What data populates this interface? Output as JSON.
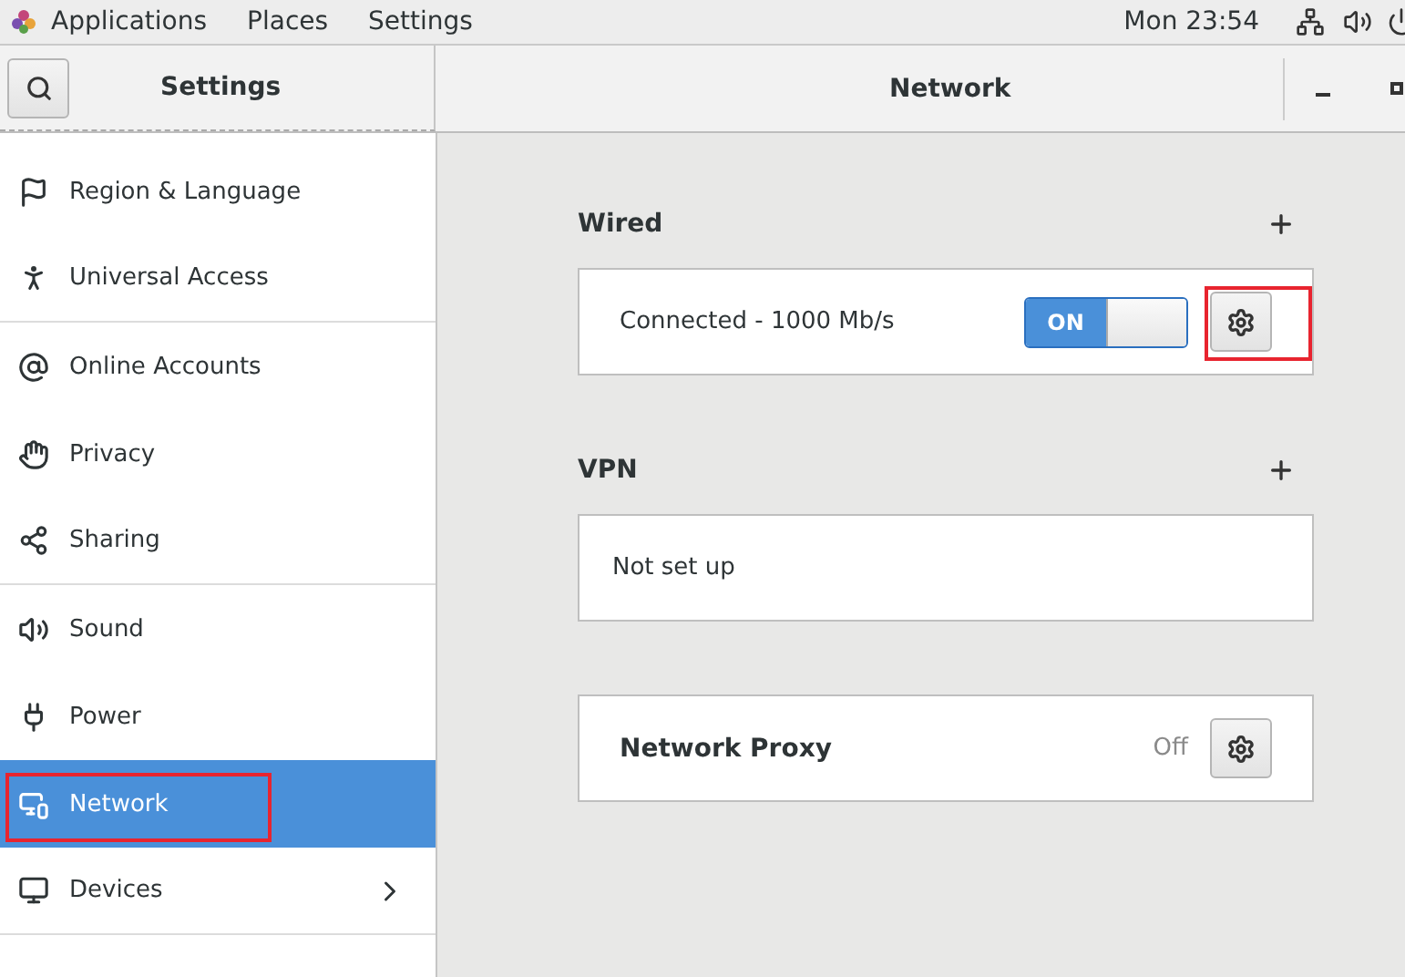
{
  "top_bar": {
    "menus": [
      "Applications",
      "Places",
      "Settings"
    ],
    "clock": "Mon 23:54"
  },
  "header": {
    "sidebar_title": "Settings",
    "title": "Network"
  },
  "sidebar": {
    "items": [
      {
        "label": "Region & Language",
        "selected": false,
        "highlighted": false,
        "has_children": false,
        "group_end": false
      },
      {
        "label": "Universal Access",
        "selected": false,
        "highlighted": false,
        "has_children": false,
        "group_end": true
      },
      {
        "label": "Online Accounts",
        "selected": false,
        "highlighted": false,
        "has_children": false,
        "group_end": false
      },
      {
        "label": "Privacy",
        "selected": false,
        "highlighted": false,
        "has_children": false,
        "group_end": false
      },
      {
        "label": "Sharing",
        "selected": false,
        "highlighted": false,
        "has_children": false,
        "group_end": true
      },
      {
        "label": "Sound",
        "selected": false,
        "highlighted": false,
        "has_children": false,
        "group_end": false
      },
      {
        "label": "Power",
        "selected": false,
        "highlighted": false,
        "has_children": false,
        "group_end": false
      },
      {
        "label": "Network",
        "selected": true,
        "highlighted": true,
        "has_children": false,
        "group_end": false
      },
      {
        "label": "Devices",
        "selected": false,
        "highlighted": false,
        "has_children": true,
        "group_end": true
      }
    ]
  },
  "sections": [
    {
      "heading": "Wired",
      "rows": [
        {
          "kind": "connection",
          "label": "Connected - 1000 Mb/s",
          "switch_label": "ON",
          "on": true,
          "highlighted": true
        }
      ]
    },
    {
      "heading": "VPN",
      "rows": [
        {
          "kind": "empty",
          "label": "Not set up"
        }
      ]
    },
    {
      "rows": [
        {
          "kind": "proxy",
          "label": "Network Proxy",
          "status": "Off"
        }
      ]
    }
  ]
}
